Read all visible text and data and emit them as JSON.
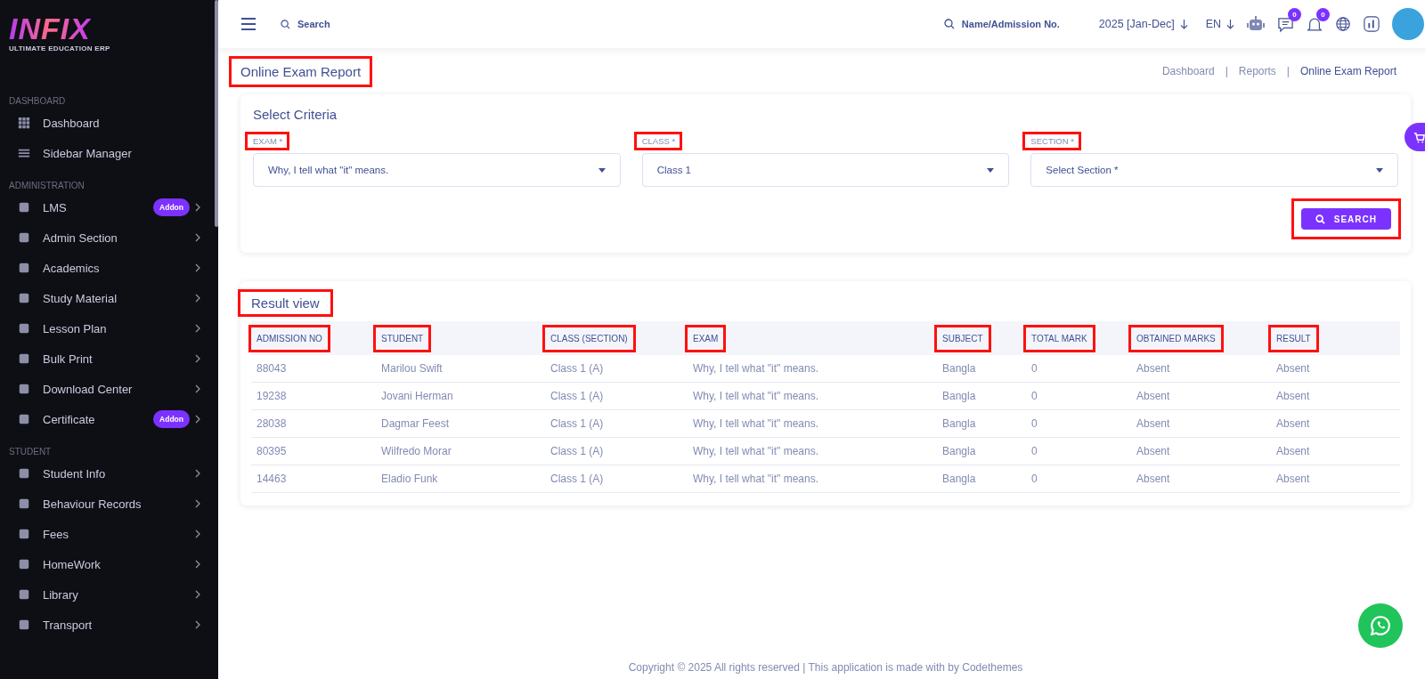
{
  "logo": {
    "name": "INFIX",
    "tagline": "ULTIMATE EDUCATION ERP"
  },
  "sidebar": {
    "sections": [
      {
        "title": "DASHBOARD",
        "items": [
          {
            "label": "Dashboard",
            "has_submenu": false
          },
          {
            "label": "Sidebar Manager",
            "has_submenu": false
          }
        ]
      },
      {
        "title": "ADMINISTRATION",
        "items": [
          {
            "label": "LMS",
            "badge": "Addon",
            "has_submenu": true
          },
          {
            "label": "Admin Section",
            "has_submenu": true
          },
          {
            "label": "Academics",
            "has_submenu": true
          },
          {
            "label": "Study Material",
            "has_submenu": true
          },
          {
            "label": "Lesson Plan",
            "has_submenu": true
          },
          {
            "label": "Bulk Print",
            "has_submenu": true
          },
          {
            "label": "Download Center",
            "has_submenu": true
          },
          {
            "label": "Certificate",
            "badge": "Addon",
            "has_submenu": true
          }
        ]
      },
      {
        "title": "STUDENT",
        "items": [
          {
            "label": "Student Info",
            "has_submenu": true
          },
          {
            "label": "Behaviour Records",
            "has_submenu": true
          },
          {
            "label": "Fees",
            "has_submenu": true
          },
          {
            "label": "HomeWork",
            "has_submenu": true
          },
          {
            "label": "Library",
            "has_submenu": true
          },
          {
            "label": "Transport",
            "has_submenu": true
          }
        ]
      }
    ]
  },
  "topbar": {
    "search": {
      "placeholder": "Search"
    },
    "student_search": {
      "placeholder": "Name/Admission No."
    },
    "session": "2025 [Jan-Dec]",
    "language": "EN",
    "messages_count": "0",
    "notifications_count": "0"
  },
  "page_title": {
    "text": "Online Exam Report",
    "highlighted": true
  },
  "breadcrumb": {
    "separator": "|",
    "items": [
      {
        "label": "Dashboard",
        "current": false
      },
      {
        "label": "Reports",
        "current": false
      },
      {
        "label": "Online Exam Report",
        "current": true
      }
    ]
  },
  "criteria": {
    "title": "Select Criteria",
    "filters": [
      {
        "label": "EXAM *",
        "value": "Why, I tell what \"it\" means.",
        "highlighted": true
      },
      {
        "label": "CLASS *",
        "value": "Class 1",
        "highlighted": true
      },
      {
        "label": "SECTION *",
        "placeholder": "Select Section *",
        "highlighted": true
      }
    ],
    "search_button": {
      "label": "SEARCH",
      "highlighted": true
    }
  },
  "result": {
    "title": {
      "text": "Result view",
      "highlighted": true
    },
    "columns": [
      {
        "label": "ADMISSION NO",
        "highlighted": true
      },
      {
        "label": "STUDENT",
        "highlighted": true
      },
      {
        "label": "CLASS (SECTION)",
        "highlighted": true
      },
      {
        "label": "EXAM",
        "highlighted": true
      },
      {
        "label": "SUBJECT",
        "highlighted": true
      },
      {
        "label": "TOTAL MARK",
        "highlighted": true
      },
      {
        "label": "OBTAINED MARKS",
        "highlighted": true
      },
      {
        "label": "RESULT",
        "highlighted": true
      }
    ],
    "rows": [
      [
        "88043",
        "Marilou Swift",
        "Class 1 (A)",
        "Why, I tell what \"it\" means.",
        "Bangla",
        "0",
        "Absent",
        "Absent"
      ],
      [
        "19238",
        "Jovani Herman",
        "Class 1 (A)",
        "Why, I tell what \"it\" means.",
        "Bangla",
        "0",
        "Absent",
        "Absent"
      ],
      [
        "28038",
        "Dagmar Feest",
        "Class 1 (A)",
        "Why, I tell what \"it\" means.",
        "Bangla",
        "0",
        "Absent",
        "Absent"
      ],
      [
        "80395",
        "Wilfredo Morar",
        "Class 1 (A)",
        "Why, I tell what \"it\" means.",
        "Bangla",
        "0",
        "Absent",
        "Absent"
      ],
      [
        "14463",
        "Eladio Funk",
        "Class 1 (A)",
        "Why, I tell what \"it\" means.",
        "Bangla",
        "0",
        "Absent",
        "Absent"
      ]
    ]
  },
  "footer": "Copyright © 2025 All rights reserved | This application is made with by Codethemes"
}
